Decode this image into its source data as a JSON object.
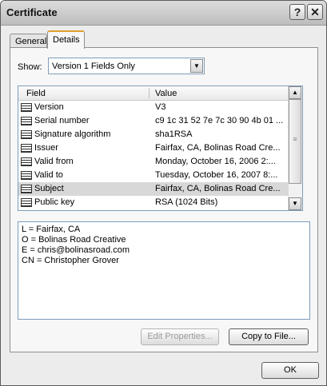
{
  "window": {
    "title": "Certificate"
  },
  "titlebar": {
    "help_label": "?",
    "close_label": "✕"
  },
  "tabs": [
    {
      "label": "General"
    },
    {
      "label": "Details"
    }
  ],
  "show": {
    "label": "Show:",
    "selected": "Version 1 Fields Only"
  },
  "list": {
    "columns": {
      "field": "Field",
      "value": "Value"
    },
    "rows": [
      {
        "field": "Version",
        "value": "V3"
      },
      {
        "field": "Serial number",
        "value": "c9 1c 31 52 7e 7c 30 90 4b 01 ..."
      },
      {
        "field": "Signature algorithm",
        "value": "sha1RSA"
      },
      {
        "field": "Issuer",
        "value": "Fairfax, CA, Bolinas Road Cre..."
      },
      {
        "field": "Valid from",
        "value": "Monday, October 16, 2006 2:..."
      },
      {
        "field": "Valid to",
        "value": "Tuesday, October 16, 2007 8:..."
      },
      {
        "field": "Subject",
        "value": "Fairfax, CA, Bolinas Road Cre...",
        "selected": true
      },
      {
        "field": "Public key",
        "value": "RSA (1024 Bits)"
      }
    ]
  },
  "detail": {
    "lines": [
      "L = Fairfax, CA",
      "O = Bolinas Road Creative",
      "E = chris@bolinasroad.com",
      "CN = Christopher Grover"
    ]
  },
  "buttons": {
    "edit_properties": "Edit Properties...",
    "copy_to_file": "Copy to File...",
    "ok": "OK"
  },
  "icons": {
    "row_icon": "certificate-field-icon",
    "scroll_up": "scroll-up-arrow-icon",
    "scroll_down": "scroll-down-arrow-icon",
    "dropdown": "chevron-down-icon"
  }
}
